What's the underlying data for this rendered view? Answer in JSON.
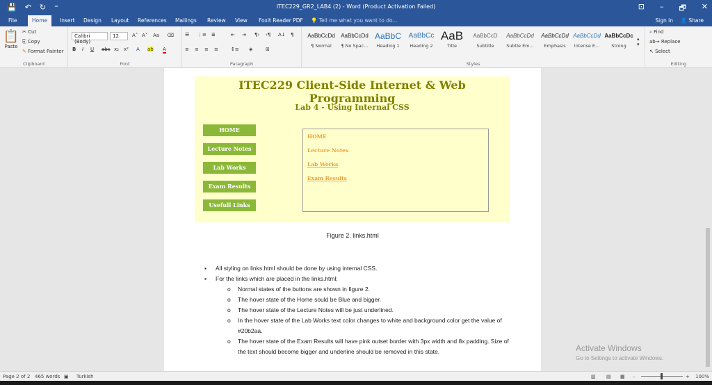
{
  "window": {
    "title": "ITEC229_GR2_LAB4 (2) - Word (Product Activation Failed)",
    "minimize": "–",
    "restore": "🗗",
    "close": "✕"
  },
  "qat": {
    "save": "💾",
    "undo": "↶",
    "redo": "↻",
    "more": "⁼"
  },
  "tabs": [
    "File",
    "Home",
    "Insert",
    "Design",
    "Layout",
    "References",
    "Mailings",
    "Review",
    "View",
    "Foxit Reader PDF"
  ],
  "tell_me": "Tell me what you want to do...",
  "sign_in": "Sign in",
  "share": "Share",
  "clipboard": {
    "paste": "Paste",
    "cut": "Cut",
    "copy": "Copy",
    "format_painter": "Format Painter",
    "label": "Clipboard"
  },
  "font": {
    "name": "Calibri (Body)",
    "size": "12",
    "label": "Font"
  },
  "paragraph": {
    "label": "Paragraph"
  },
  "styles": {
    "label": "Styles",
    "items": [
      {
        "sample": "AaBbCcDd",
        "name": "¶ Normal"
      },
      {
        "sample": "AaBbCcDd",
        "name": "¶ No Spac..."
      },
      {
        "sample": "AaBbC",
        "name": "Heading 1"
      },
      {
        "sample": "AaBbCc",
        "name": "Heading 2"
      },
      {
        "sample": "AaB",
        "name": "Title"
      },
      {
        "sample": "AaBbCcD",
        "name": "Subtitle"
      },
      {
        "sample": "AaBbCcDd",
        "name": "Subtle Em..."
      },
      {
        "sample": "AaBbCcDd",
        "name": "Emphasis"
      },
      {
        "sample": "AaBbCcDd",
        "name": "Intense E..."
      },
      {
        "sample": "AaBbCcDc",
        "name": "Strong"
      }
    ]
  },
  "editing": {
    "find": "Find",
    "replace": "Replace",
    "select": "Select",
    "label": "Editing"
  },
  "document": {
    "figure": {
      "heading": "ITEC229 Client-Side Internet & Web Programming",
      "subheading": "Lab 4 - Using Internal CSS",
      "buttons": [
        "HOME",
        "Lecture Notes",
        "Lab Works",
        "Exam Results",
        "Usefull Links"
      ],
      "links": [
        "HOME",
        "Lecture Notes",
        "Lab Works",
        "Exam Results"
      ]
    },
    "caption": "Figure 2. links.html",
    "bullets": [
      "All styling on links.html should be done by using internal CSS.",
      "For the links which are placed in the links.html;"
    ],
    "sub_bullets": [
      "Normal states of the buttons are shown in figure 2.",
      "The hover state of the Home sould be Blue and bigger.",
      "The hover state of the Lecture Notes will be just underlined.",
      "In the hover state of the Lab Works text color changes to white and background color get the value of #20b2aa.",
      "The hover state of the Exam Results will have pink outset border with 3px width and 8x padding. Size of the text should become bigger and underline should be removed in this state."
    ]
  },
  "activation": {
    "title": "Activate Windows",
    "subtitle": "Go to Settings to activate Windows."
  },
  "status": {
    "page": "Page 2 of 2",
    "words": "465 words",
    "language": "Turkish",
    "zoom": "100%"
  },
  "colors": {
    "accent": "#2b579a",
    "figure_bg": "#ffffcc",
    "heading_olive": "#808000",
    "button_green": "#8cb83a",
    "link_orange": "#e8a33c"
  }
}
